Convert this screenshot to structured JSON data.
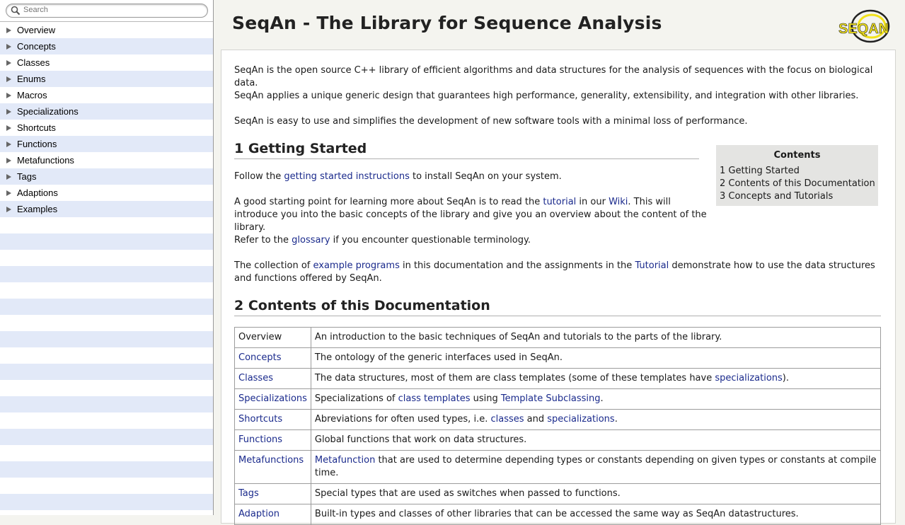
{
  "search": {
    "placeholder": "Search"
  },
  "sidebar": {
    "items": [
      {
        "label": "Overview"
      },
      {
        "label": "Concepts"
      },
      {
        "label": "Classes"
      },
      {
        "label": "Enums"
      },
      {
        "label": "Macros"
      },
      {
        "label": "Specializations"
      },
      {
        "label": "Shortcuts"
      },
      {
        "label": "Functions"
      },
      {
        "label": "Metafunctions"
      },
      {
        "label": "Tags"
      },
      {
        "label": "Adaptions"
      },
      {
        "label": "Examples"
      }
    ]
  },
  "header": {
    "title": "SeqAn - The Library for Sequence Analysis",
    "logo_text": "SEQAN"
  },
  "intro": {
    "p1": "SeqAn is the open source C++ library of efficient algorithms and data structures for the analysis of sequences with the focus on biological data.",
    "p2": "SeqAn applies a unique generic design that guarantees high performance, generality, extensibility, and integration with other libraries.",
    "p3": "SeqAn is easy to use and simplifies the development of new software tools with a minimal loss of performance."
  },
  "section1": {
    "heading": "1 Getting Started",
    "p_follow": {
      "a": "Follow the ",
      "link": "getting started instructions",
      "b": " to install SeqAn on your system."
    },
    "p_start": {
      "a": "A good starting point for learning more about SeqAn is to read the ",
      "link1": "tutorial",
      "b": " in our ",
      "link2": "Wiki",
      "c": ". This will introduce you into the basic concepts of the library and give you an overview about the content of the library."
    },
    "p_gloss": {
      "a": "Refer to the ",
      "link": "glossary",
      "b": " if you encounter questionable terminology."
    },
    "p_coll": {
      "a": "The collection of ",
      "link1": "example programs",
      "b": " in this documentation and the assignments in the ",
      "link2": "Tutorial",
      "c": " demonstrate how to use the data structures and functions offered by SeqAn."
    }
  },
  "toc": {
    "title": "Contents",
    "items": [
      "1 Getting Started",
      "2 Contents of this Documentation",
      "3 Concepts and Tutorials"
    ]
  },
  "section2": {
    "heading": "2 Contents of this Documentation",
    "rows": [
      {
        "name": "Overview",
        "desc": "An introduction to the basic techniques of SeqAn and tutorials to the parts of the library."
      },
      {
        "name": "Concepts",
        "desc": "The ontology of the generic interfaces used in SeqAn."
      },
      {
        "name": "Classes",
        "desc_a": "The data structures, most of them are class templates (some of these templates have ",
        "desc_link": "specializations",
        "desc_b": ")."
      },
      {
        "name": "Specializations",
        "desc_a": "Specializations of ",
        "desc_link1": "class templates",
        "desc_b": " using ",
        "desc_link2": "Template Subclassing",
        "desc_c": "."
      },
      {
        "name": "Shortcuts",
        "desc_a": "Abreviations for often used types, i.e. ",
        "desc_link1": "classes",
        "desc_b": " and ",
        "desc_link2": "specializations",
        "desc_c": "."
      },
      {
        "name": "Functions",
        "desc": "Global functions that work on data structures."
      },
      {
        "name": "Metafunctions",
        "desc_link": "Metafunction",
        "desc_b": " that are used to determine depending types or constants depending on given types or constants at compile time."
      },
      {
        "name": "Tags",
        "desc": "Special types that are used as switches when passed to functions."
      },
      {
        "name": "Adaption",
        "desc": "Built-in types and classes of other libraries that can be accessed the same way as SeqAn datastructures."
      }
    ]
  },
  "colors": {
    "link": "#1a2a8c",
    "sidebar_stripe": "#e2e9f8",
    "logo_yellow": "#f2e21a"
  }
}
